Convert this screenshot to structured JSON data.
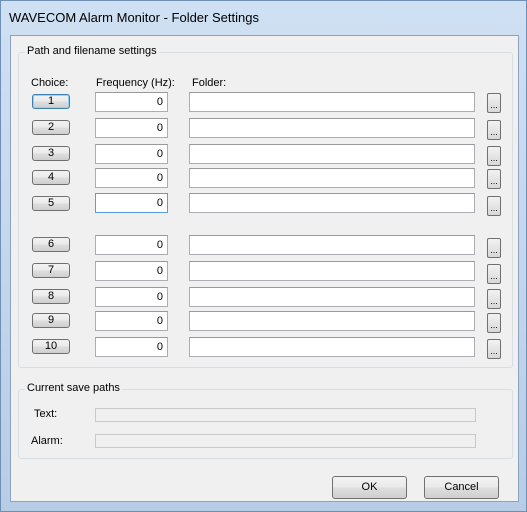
{
  "window": {
    "title": "WAVECOM Alarm Monitor - Folder Settings"
  },
  "path_group": {
    "label": "Path and filename settings",
    "col_choice": "Choice:",
    "col_frequency": "Frequency (Hz):",
    "col_folder": "Folder:",
    "rows": [
      {
        "choice": "1",
        "frequency": "0",
        "folder": ""
      },
      {
        "choice": "2",
        "frequency": "0",
        "folder": ""
      },
      {
        "choice": "3",
        "frequency": "0",
        "folder": ""
      },
      {
        "choice": "4",
        "frequency": "0",
        "folder": ""
      },
      {
        "choice": "5",
        "frequency": "0",
        "folder": ""
      },
      {
        "choice": "6",
        "frequency": "0",
        "folder": ""
      },
      {
        "choice": "7",
        "frequency": "0",
        "folder": ""
      },
      {
        "choice": "8",
        "frequency": "0",
        "folder": ""
      },
      {
        "choice": "9",
        "frequency": "0",
        "folder": ""
      },
      {
        "choice": "10",
        "frequency": "0",
        "folder": ""
      }
    ],
    "browse_label": "..."
  },
  "save_group": {
    "label": "Current save paths",
    "text_label": "Text:",
    "text_value": "",
    "alarm_label": "Alarm:",
    "alarm_value": ""
  },
  "buttons": {
    "ok": "OK",
    "cancel": "Cancel"
  }
}
